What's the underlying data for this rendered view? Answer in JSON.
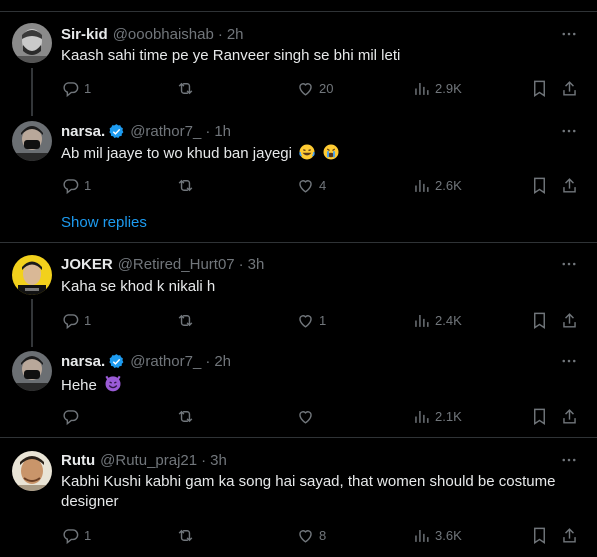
{
  "colors": {
    "background": "#000000",
    "text": "#e7e9ea",
    "muted": "#71767b",
    "accent": "#1d9bf0",
    "verified": "#1d9bf0",
    "divider": "#2f3336"
  },
  "replies": [
    {
      "name": "Sir-kid",
      "handle": "@ooobhaishab",
      "time": "2h",
      "verified": false,
      "text": "Kaash sahi time pe ye Ranveer singh se bhi mil leti",
      "reply_count": "1",
      "retweet_count": "",
      "like_count": "20",
      "view_count": "2.9K"
    },
    {
      "name": "narsa.",
      "handle": "@rathor7_",
      "time": "1h",
      "verified": true,
      "text": "Ab mil jaaye to wo khud ban jayegi",
      "emojis": [
        "laughing-tears-emoji",
        "crying-face-emoji"
      ],
      "reply_count": "1",
      "retweet_count": "",
      "like_count": "4",
      "view_count": "2.6K"
    },
    {
      "name": "JOKER",
      "handle": "@Retired_Hurt07",
      "time": "3h",
      "verified": false,
      "text": "Kaha se khod k nikali h",
      "reply_count": "1",
      "retweet_count": "",
      "like_count": "1",
      "view_count": "2.4K"
    },
    {
      "name": "narsa.",
      "handle": "@rathor7_",
      "time": "2h",
      "verified": true,
      "text": "Hehe",
      "emojis": [
        "smiling-devil-emoji"
      ],
      "reply_count": "",
      "retweet_count": "",
      "like_count": "",
      "view_count": "2.1K"
    },
    {
      "name": "Rutu",
      "handle": "@Rutu_praj21",
      "time": "3h",
      "verified": false,
      "text": "Kabhi Kushi kabhi gam ka song hai sayad, that women should be costume designer",
      "reply_count": "1",
      "retweet_count": "",
      "like_count": "8",
      "view_count": "3.6K"
    }
  ],
  "show_replies_label": "Show replies",
  "icons": {
    "reply": "reply-icon",
    "retweet": "retweet-icon",
    "like": "like-icon",
    "views": "views-icon",
    "bookmark": "bookmark-icon",
    "share": "share-icon",
    "more": "more-icon",
    "verified": "verified-badge-icon"
  }
}
